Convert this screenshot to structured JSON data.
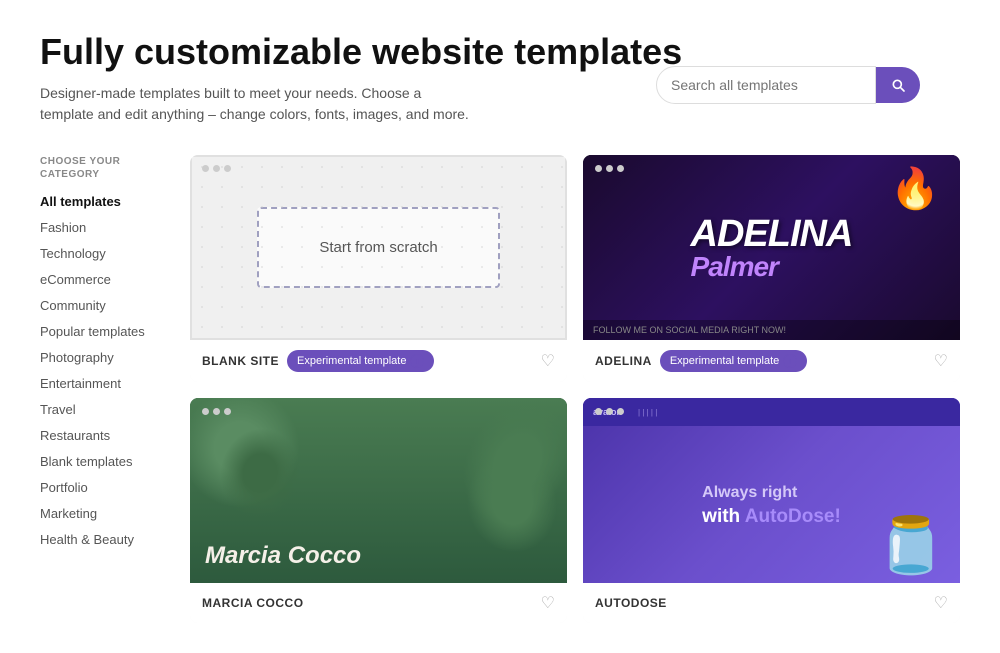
{
  "page": {
    "title": "Fully customizable website templates",
    "subtitle": "Designer-made templates built to meet your needs. Choose a template and edit anything – change colors, fonts, images, and more."
  },
  "search": {
    "placeholder": "Search all templates",
    "button_label": "Search"
  },
  "sidebar": {
    "heading": "CHOOSE YOUR CATEGORY",
    "categories": [
      {
        "id": "all",
        "label": "All templates",
        "active": true
      },
      {
        "id": "fashion",
        "label": "Fashion",
        "active": false
      },
      {
        "id": "technology",
        "label": "Technology",
        "active": false
      },
      {
        "id": "ecommerce",
        "label": "eCommerce",
        "active": false
      },
      {
        "id": "community",
        "label": "Community",
        "active": false
      },
      {
        "id": "popular",
        "label": "Popular templates",
        "active": false
      },
      {
        "id": "photography",
        "label": "Photography",
        "active": false
      },
      {
        "id": "entertainment",
        "label": "Entertainment",
        "active": false
      },
      {
        "id": "travel",
        "label": "Travel",
        "active": false
      },
      {
        "id": "restaurants",
        "label": "Restaurants",
        "active": false
      },
      {
        "id": "blank",
        "label": "Blank templates",
        "active": false
      },
      {
        "id": "portfolio",
        "label": "Portfolio",
        "active": false
      },
      {
        "id": "marketing",
        "label": "Marketing",
        "active": false
      },
      {
        "id": "health",
        "label": "Health & Beauty",
        "active": false
      }
    ]
  },
  "templates": [
    {
      "id": "blank-site",
      "name": "BLANK SITE",
      "badge": "Experimental template",
      "type": "blank"
    },
    {
      "id": "adelina",
      "name": "ADELINA",
      "badge": "Experimental template",
      "type": "adelina"
    },
    {
      "id": "marcia",
      "name": "MARCIA COCCO",
      "badge": null,
      "type": "marcia"
    },
    {
      "id": "autodose",
      "name": "AUTODOSE",
      "badge": null,
      "type": "autodose"
    }
  ],
  "labels": {
    "start_from_scratch": "Start from scratch",
    "adelina_top": "ADELINA",
    "adelina_bot": "Palmer",
    "marcia_title": "Marcia Cocco",
    "autodose_line1": "Always right",
    "autodose_line2": "with AutoDose!",
    "heart": "♡"
  }
}
